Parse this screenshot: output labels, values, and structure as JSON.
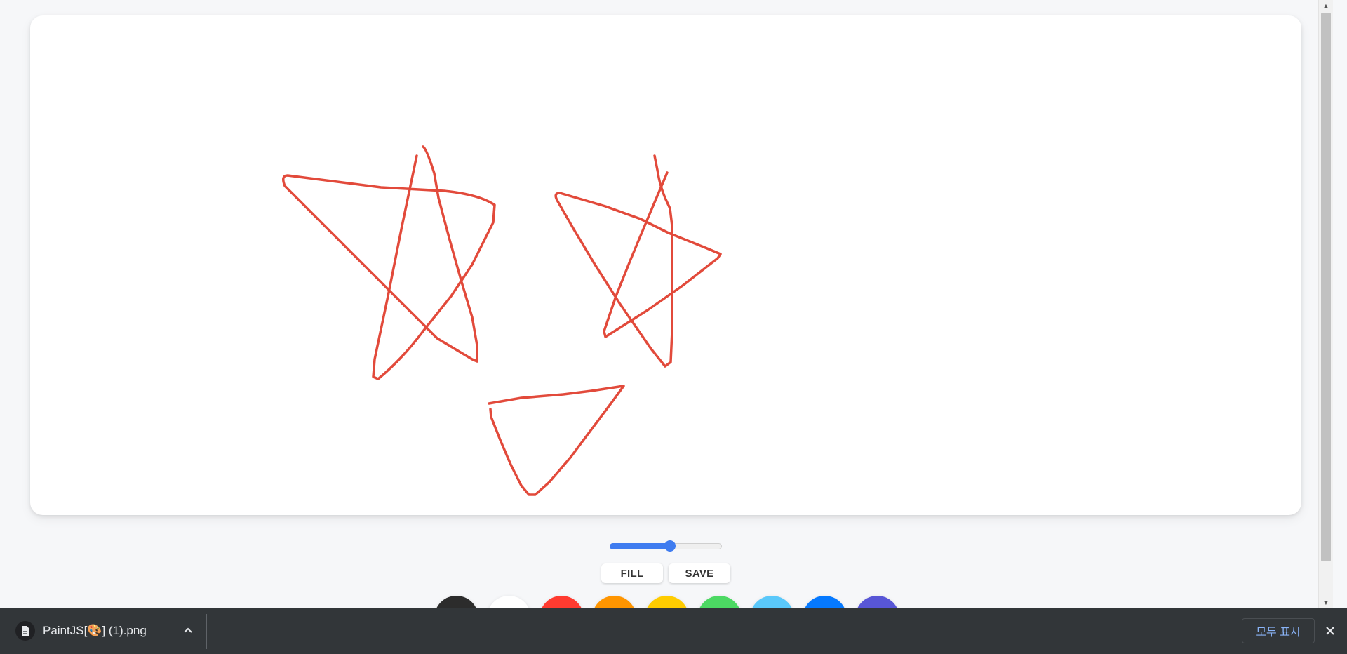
{
  "toolbar": {
    "fill_label": "FILL",
    "save_label": "SAVE",
    "brush_size": {
      "value": 5.5,
      "min": 0.1,
      "max": 10
    }
  },
  "palette": [
    {
      "name": "black",
      "color": "#2c2c2c"
    },
    {
      "name": "white",
      "color": "#ffffff"
    },
    {
      "name": "red",
      "color": "#ff3b30"
    },
    {
      "name": "orange",
      "color": "#ff9500"
    },
    {
      "name": "yellow",
      "color": "#ffcc00"
    },
    {
      "name": "green",
      "color": "#4cd963"
    },
    {
      "name": "skyblue",
      "color": "#5ac8fa"
    },
    {
      "name": "blue",
      "color": "#0579ff"
    },
    {
      "name": "purple",
      "color": "#5856d6"
    }
  ],
  "drawing": {
    "stroke_color": "#e24a3b"
  },
  "download_bar": {
    "file_name": "PaintJS[🎨] (1).png",
    "show_all_label": "모두 표시"
  }
}
